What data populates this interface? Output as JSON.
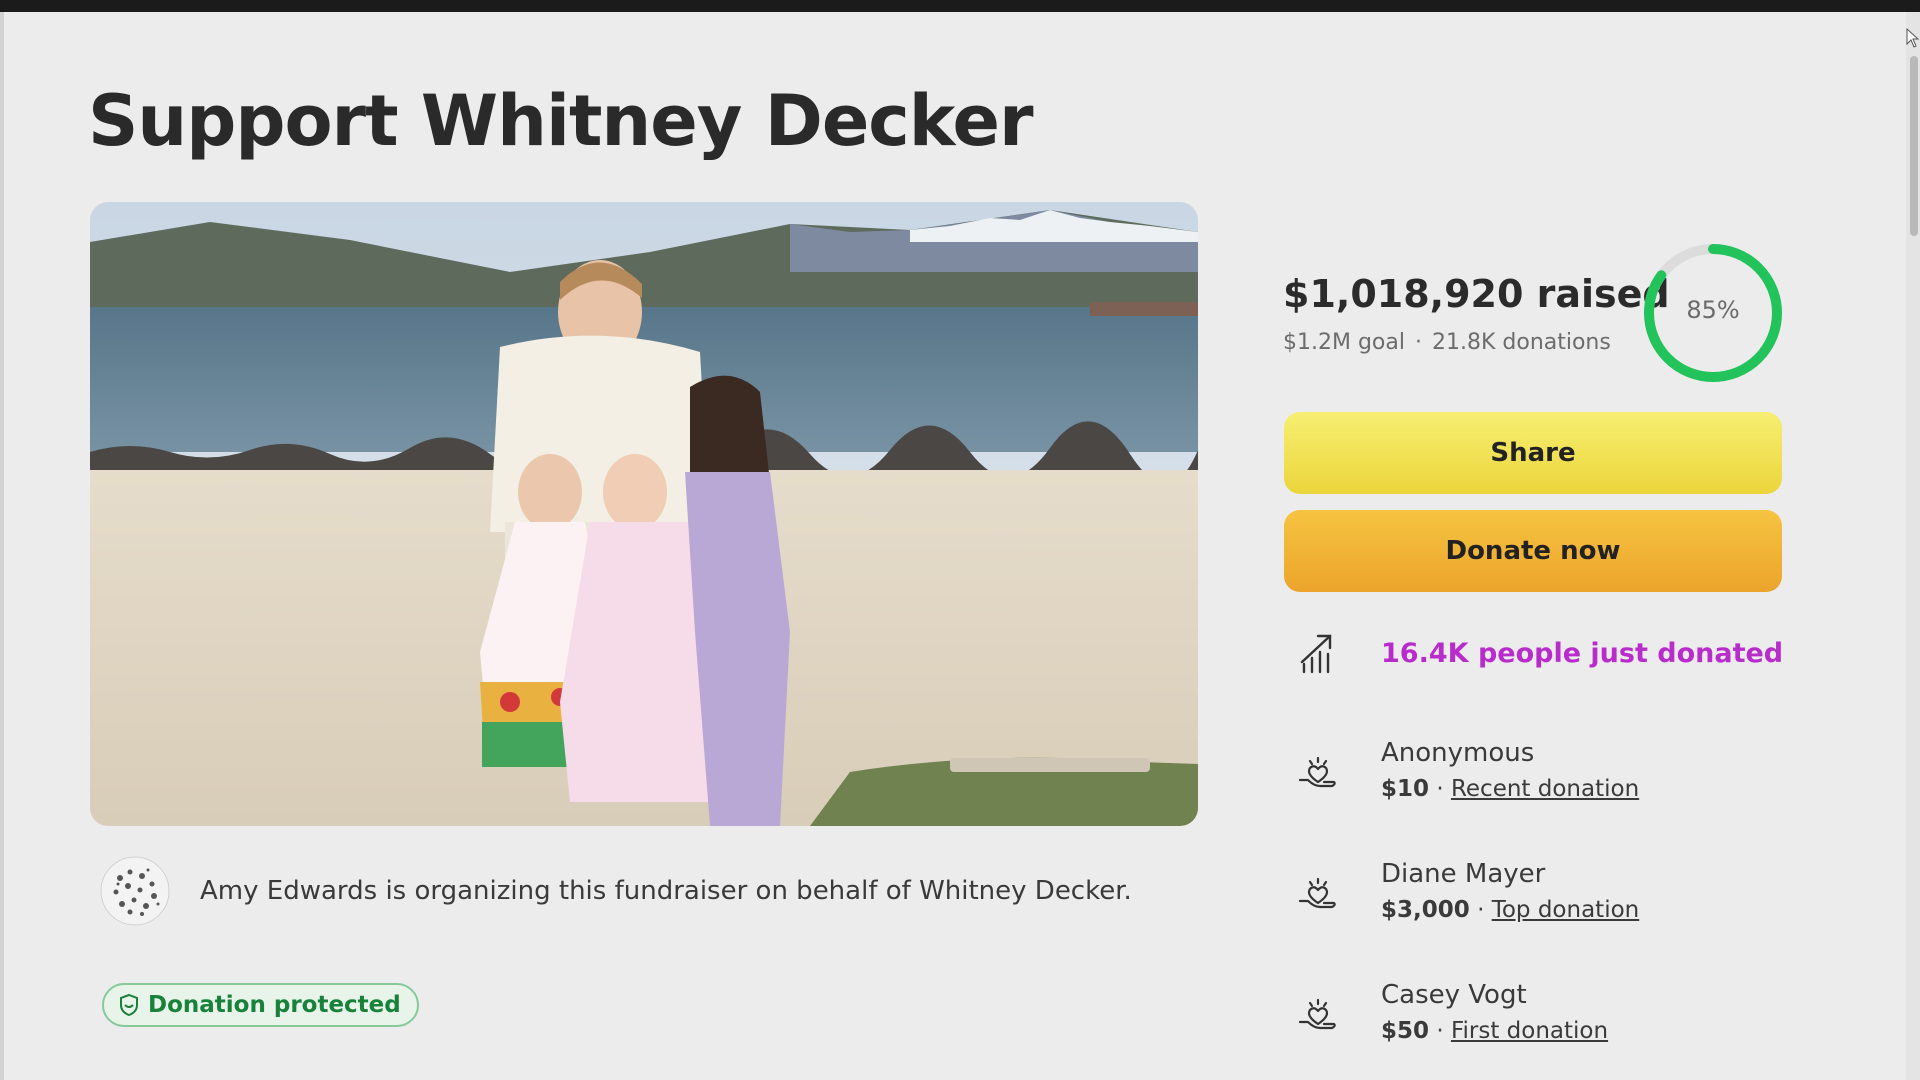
{
  "page": {
    "title": "Support Whitney Decker"
  },
  "organizer": {
    "text": "Amy Edwards is organizing this fundraiser on behalf of Whitney Decker."
  },
  "badge": {
    "label": "Donation protected",
    "icon": "shield-icon"
  },
  "stats": {
    "raised": "$1,018,920 raised",
    "goal": "$1.2M goal",
    "separator": "·",
    "donations": "21.8K donations",
    "percent_label": "85%",
    "percent": 85
  },
  "actions": {
    "share_label": "Share",
    "donate_label": "Donate now"
  },
  "activity": {
    "text": "16.4K people just donated",
    "icon": "trending-up-icon"
  },
  "donors": [
    {
      "name": "Anonymous",
      "amount": "$10",
      "sep": " · ",
      "tag": "Recent donation"
    },
    {
      "name": "Diane Mayer",
      "amount": "$3,000",
      "sep": " · ",
      "tag": "Top donation"
    },
    {
      "name": "Casey Vogt",
      "amount": "$50",
      "sep": " · ",
      "tag": "First donation"
    }
  ],
  "colors": {
    "accent_green": "#21c35a",
    "activity_purple": "#b92ccc",
    "share_yellow": "#f2e256",
    "donate_orange": "#f0b335"
  }
}
